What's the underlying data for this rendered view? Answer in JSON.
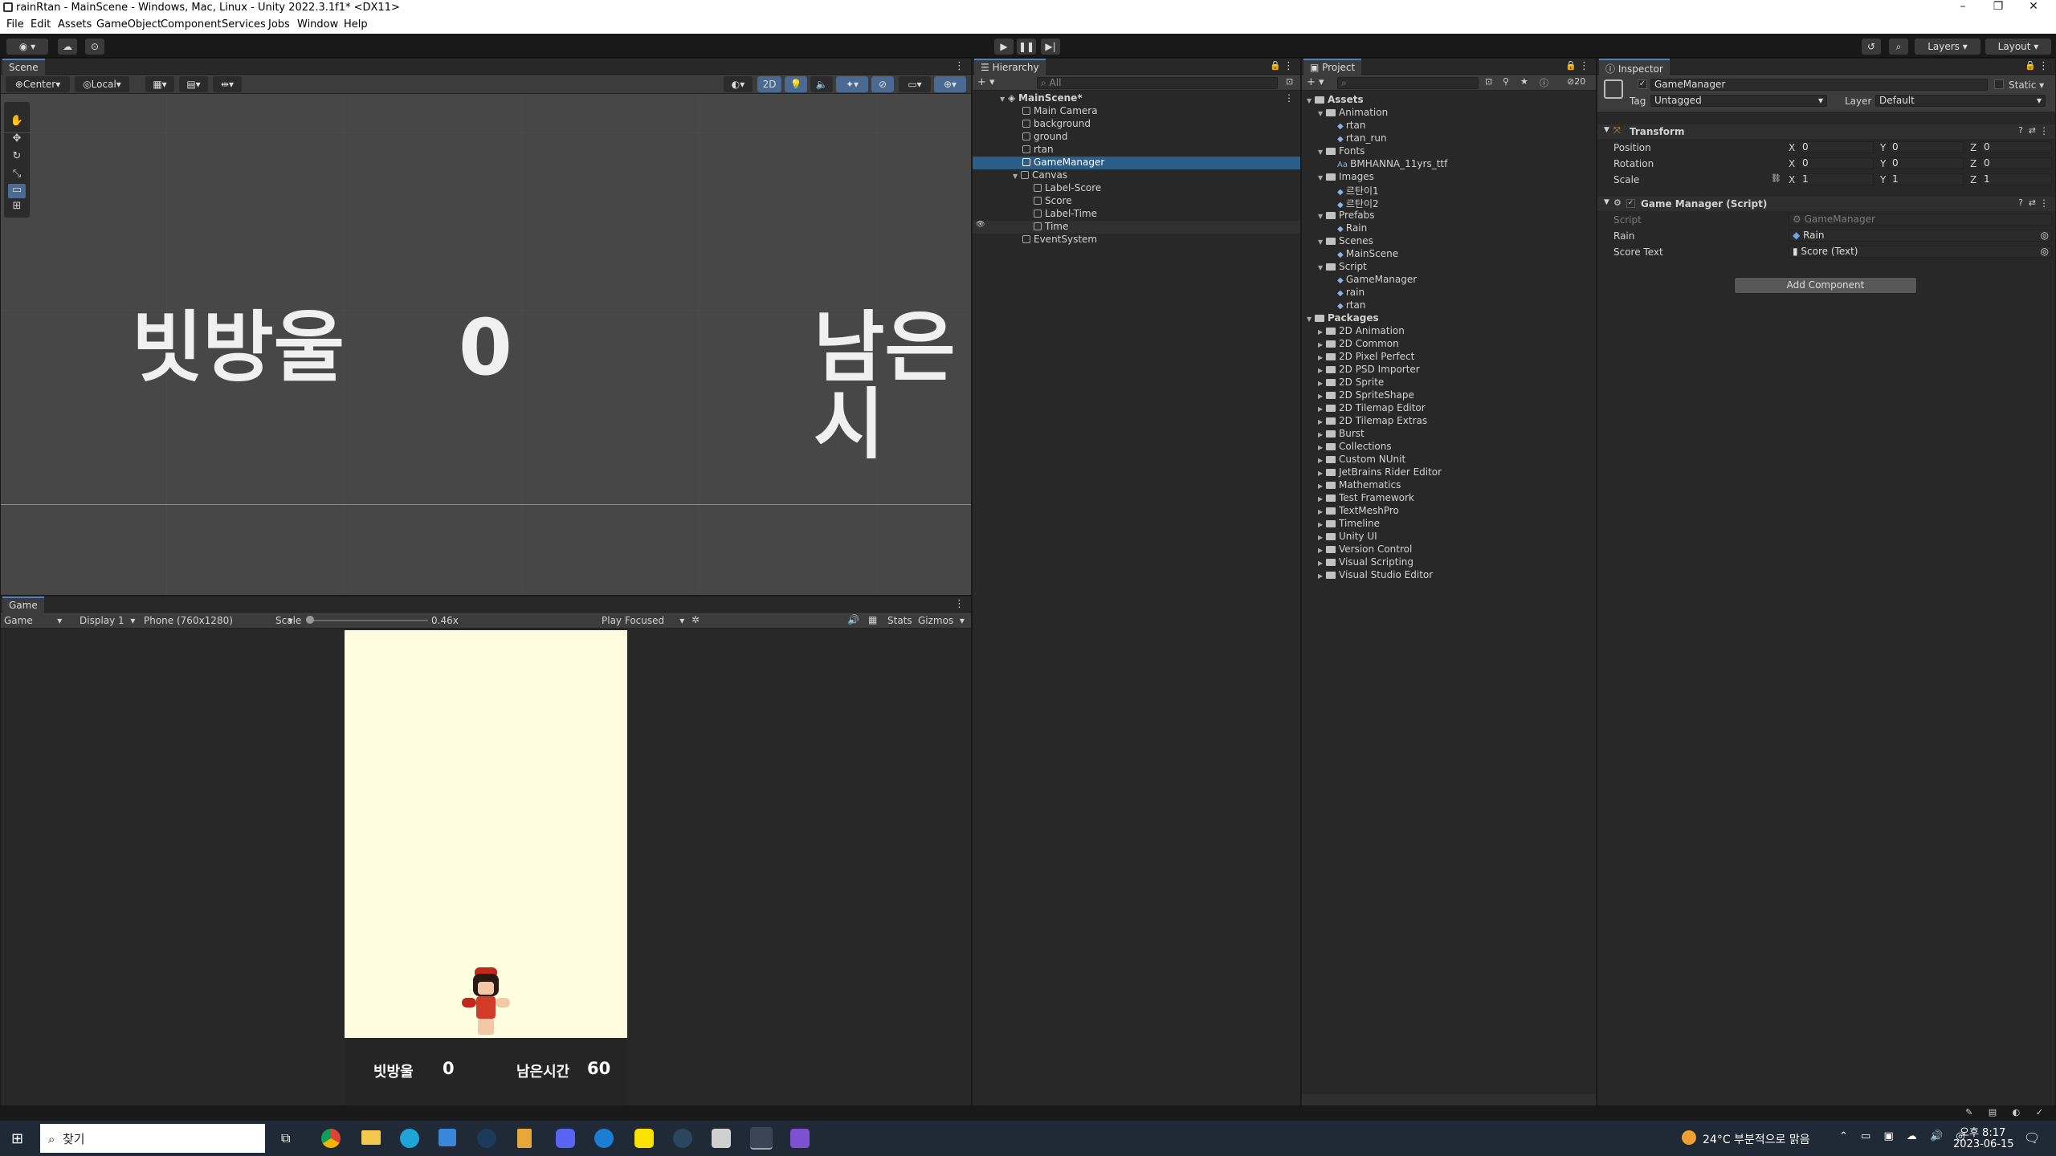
{
  "window": {
    "title": "rainRtan - MainScene - Windows, Mac, Linux - Unity 2022.3.1f1* <DX11>"
  },
  "menu": [
    "File",
    "Edit",
    "Assets",
    "GameObject",
    "Component",
    "Services",
    "Jobs",
    "Window",
    "Help"
  ],
  "toolbar": {
    "layers": "Layers",
    "layout": "Layout"
  },
  "scene": {
    "tab": "Scene",
    "pivot": "Center",
    "space": "Local",
    "mode_2d": "2D",
    "texts": [
      "빗방울",
      "0",
      "남은시"
    ]
  },
  "game": {
    "tab": "Game",
    "mode": "Game",
    "display": "Display 1",
    "resolution": "Phone (760x1280)",
    "scale_label": "Scale",
    "scale_value": "0.46x",
    "play_focus": "Play Focused",
    "stats": "Stats",
    "gizmos": "Gizmos",
    "hud": {
      "score_label": "빗방울",
      "score": "0",
      "time_label": "남은시간",
      "time": "60"
    }
  },
  "hierarchy": {
    "tab": "Hierarchy",
    "search_placeholder": "All",
    "items": [
      {
        "label": "MainScene*",
        "depth": 0
      },
      {
        "label": "Main Camera",
        "depth": 1
      },
      {
        "label": "background",
        "depth": 1
      },
      {
        "label": "ground",
        "depth": 1
      },
      {
        "label": "rtan",
        "depth": 1
      },
      {
        "label": "GameManager",
        "depth": 1,
        "selected": true
      },
      {
        "label": "Canvas",
        "depth": 1
      },
      {
        "label": "Label-Score",
        "depth": 2
      },
      {
        "label": "Score",
        "depth": 2
      },
      {
        "label": "Label-Time",
        "depth": 2
      },
      {
        "label": "Time",
        "depth": 2
      },
      {
        "label": "EventSystem",
        "depth": 1
      }
    ]
  },
  "project": {
    "tab": "Project",
    "count": "20",
    "items": [
      {
        "label": "Assets",
        "depth": 0,
        "kind": "folder"
      },
      {
        "label": "Animation",
        "depth": 1,
        "kind": "folder"
      },
      {
        "label": "rtan",
        "depth": 2,
        "kind": "file"
      },
      {
        "label": "rtan_run",
        "depth": 2,
        "kind": "file"
      },
      {
        "label": "Fonts",
        "depth": 1,
        "kind": "folder"
      },
      {
        "label": "BMHANNA_11yrs_ttf",
        "depth": 2,
        "kind": "font"
      },
      {
        "label": "Images",
        "depth": 1,
        "kind": "folder"
      },
      {
        "label": "르탄이1",
        "depth": 2,
        "kind": "file"
      },
      {
        "label": "르탄이2",
        "depth": 2,
        "kind": "file"
      },
      {
        "label": "Prefabs",
        "depth": 1,
        "kind": "folder"
      },
      {
        "label": "Rain",
        "depth": 2,
        "kind": "file"
      },
      {
        "label": "Scenes",
        "depth": 1,
        "kind": "folder"
      },
      {
        "label": "MainScene",
        "depth": 2,
        "kind": "file"
      },
      {
        "label": "Script",
        "depth": 1,
        "kind": "folder"
      },
      {
        "label": "GameManager",
        "depth": 2,
        "kind": "file"
      },
      {
        "label": "rain",
        "depth": 2,
        "kind": "file"
      },
      {
        "label": "rtan",
        "depth": 2,
        "kind": "file"
      },
      {
        "label": "Packages",
        "depth": 0,
        "kind": "folder"
      },
      {
        "label": "2D Animation",
        "depth": 1,
        "kind": "folder"
      },
      {
        "label": "2D Common",
        "depth": 1,
        "kind": "folder"
      },
      {
        "label": "2D Pixel Perfect",
        "depth": 1,
        "kind": "folder"
      },
      {
        "label": "2D PSD Importer",
        "depth": 1,
        "kind": "folder"
      },
      {
        "label": "2D Sprite",
        "depth": 1,
        "kind": "folder"
      },
      {
        "label": "2D SpriteShape",
        "depth": 1,
        "kind": "folder"
      },
      {
        "label": "2D Tilemap Editor",
        "depth": 1,
        "kind": "folder"
      },
      {
        "label": "2D Tilemap Extras",
        "depth": 1,
        "kind": "folder"
      },
      {
        "label": "Burst",
        "depth": 1,
        "kind": "folder"
      },
      {
        "label": "Collections",
        "depth": 1,
        "kind": "folder"
      },
      {
        "label": "Custom NUnit",
        "depth": 1,
        "kind": "folder"
      },
      {
        "label": "JetBrains Rider Editor",
        "depth": 1,
        "kind": "folder"
      },
      {
        "label": "Mathematics",
        "depth": 1,
        "kind": "folder"
      },
      {
        "label": "Test Framework",
        "depth": 1,
        "kind": "folder"
      },
      {
        "label": "TextMeshPro",
        "depth": 1,
        "kind": "folder"
      },
      {
        "label": "Timeline",
        "depth": 1,
        "kind": "folder"
      },
      {
        "label": "Unity UI",
        "depth": 1,
        "kind": "folder"
      },
      {
        "label": "Version Control",
        "depth": 1,
        "kind": "folder"
      },
      {
        "label": "Visual Scripting",
        "depth": 1,
        "kind": "folder"
      },
      {
        "label": "Visual Studio Editor",
        "depth": 1,
        "kind": "folder"
      }
    ]
  },
  "inspector": {
    "tab": "Inspector",
    "object_name": "GameManager",
    "static_label": "Static",
    "tag_label": "Tag",
    "tag_value": "Untagged",
    "layer_label": "Layer",
    "layer_value": "Default",
    "transform": {
      "title": "Transform",
      "position_label": "Position",
      "position": [
        "0",
        "0",
        "0"
      ],
      "rotation_label": "Rotation",
      "rotation": [
        "0",
        "0",
        "0"
      ],
      "scale_label": "Scale",
      "scale": [
        "1",
        "1",
        "1"
      ]
    },
    "script_component": {
      "title": "Game Manager (Script)",
      "script_label": "Script",
      "script_value": "GameManager",
      "rain_label": "Rain",
      "rain_value": "Rain",
      "score_text_label": "Score Text",
      "score_text_value": "Score (Text)"
    },
    "add_component": "Add Component"
  },
  "taskbar": {
    "search_placeholder": "찾기",
    "weather": "24°C  부분적으로 맑음",
    "time": "오후 8:17",
    "date": "2023-06-15"
  }
}
